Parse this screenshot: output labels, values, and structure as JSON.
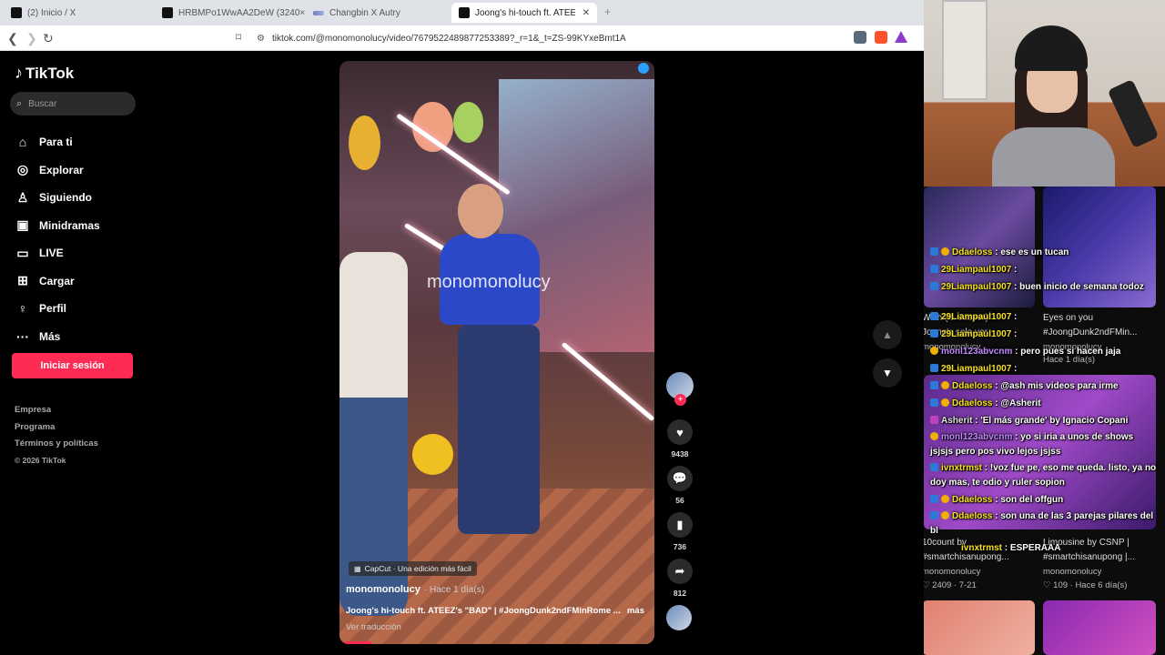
{
  "tabs": [
    {
      "label": "(2) Inicio / X",
      "favicon": "x-icon"
    },
    {
      "label": "HRBMPo1WwAA2DeW (3240×4050)",
      "favicon": "x-icon"
    },
    {
      "label": "Changbin X Autry",
      "favicon": "wave-icon"
    },
    {
      "label": "Joong's hi-touch ft. ATEEZ's \"BAD\"",
      "favicon": "tiktok-icon"
    }
  ],
  "url": "tiktok.com/@monomonolucy/video/7679522489877253389?_r=1&_t=ZS-99KYxeBmt1A",
  "sidebar": {
    "logo": "TikTok",
    "search_placeholder": "Buscar",
    "items": [
      {
        "label": "Para ti",
        "icon": "home-icon"
      },
      {
        "label": "Explorar",
        "icon": "compass-icon"
      },
      {
        "label": "Siguiendo",
        "icon": "following-icon"
      },
      {
        "label": "Minidramas",
        "icon": "minidrama-icon"
      },
      {
        "label": "LIVE",
        "icon": "live-icon"
      },
      {
        "label": "Cargar",
        "icon": "upload-icon"
      },
      {
        "label": "Perfil",
        "icon": "profile-icon"
      },
      {
        "label": "Más",
        "icon": "more-icon"
      }
    ],
    "login_label": "Iniciar sesión",
    "footer": [
      "Empresa",
      "Programa",
      "Términos y políticas",
      "© 2026 TikTok"
    ]
  },
  "video": {
    "watermark": "monomonolucy",
    "capcut": "CapCut · Una edición más fácil",
    "author": "monomonolucy",
    "ago": "· Hace 1 día(s)",
    "description": "Joong's hi-touch ft. ATEEZ's \"BAD\"  |  #JoongDunk2ndFMinRome ...",
    "more": "más",
    "translate": "Ver traducción"
  },
  "actions": {
    "likes": "9438",
    "comments": "56",
    "saves": "736",
    "shares": "812"
  },
  "side_thumbs": [
    {
      "title": "Wish (ft. Jasper)",
      "subtitle": "Joong's solo ver.",
      "author": "monomonolucy"
    },
    {
      "title": "Eyes on you",
      "subtitle": "#JoongDunk2ndFMin...",
      "author": "monomonolucy",
      "meta": "Hace 1 día(s)"
    },
    {
      "title": "10count by",
      "subtitle": "#smartchisanupong...",
      "author": "monomonolucy",
      "meta": "2409 · 7-21"
    },
    {
      "title": "Limousine by CSNP |",
      "subtitle": "#smartchisanupong |...",
      "author": "monomonolucy",
      "meta": "109 · Hace 6 día(s)"
    }
  ],
  "chat": [
    {
      "user": "Ddaeloss",
      "text": ": ese es un tucan",
      "color": "yellow"
    },
    {
      "user": "29Liampaul1007",
      "text": ":",
      "color": "yellow"
    },
    {
      "user": "29Liampaul1007",
      "text": ": buen inicio de semana todoz",
      "color": "yellow"
    },
    {
      "user": "29Liampaul1007",
      "text": ":",
      "color": "yellow"
    },
    {
      "user": "29Liampaul1007",
      "text": ":",
      "color": "yellow"
    },
    {
      "user": "monl123abvcnm",
      "text": ": pero pues si hacen jaja",
      "color": "purple"
    },
    {
      "user": "29Liampaul1007",
      "text": ":",
      "color": "yellow"
    },
    {
      "user": "Ddaeloss",
      "text": ": @ash mis videos para irme",
      "color": "yellow"
    },
    {
      "user": "Ddaeloss",
      "text": ": @Asherit",
      "color": "yellow"
    },
    {
      "user": "Asherit",
      "text": ": 'El más grande' by Ignacio Copani",
      "color": "gray"
    },
    {
      "user": "monl123abvcnm",
      "text": ": yo si iria a unos de shows jsjsjs pero pos vivo lejos jsjss",
      "color": "purple"
    },
    {
      "user": "ivnxtrmst",
      "text": ": !voz fue pe, eso me queda. listo, ya no doy mas, te odio y ruler sopion",
      "color": "yellow"
    },
    {
      "user": "Ddaeloss",
      "text": ": son del offgun",
      "color": "yellow"
    },
    {
      "user": "Ddaeloss",
      "text": ": son una de las 3 parejas pilares del bl",
      "color": "yellow"
    },
    {
      "user": "ivnxtrmst",
      "text": ": ESPERAAA",
      "color": "yellow"
    }
  ]
}
